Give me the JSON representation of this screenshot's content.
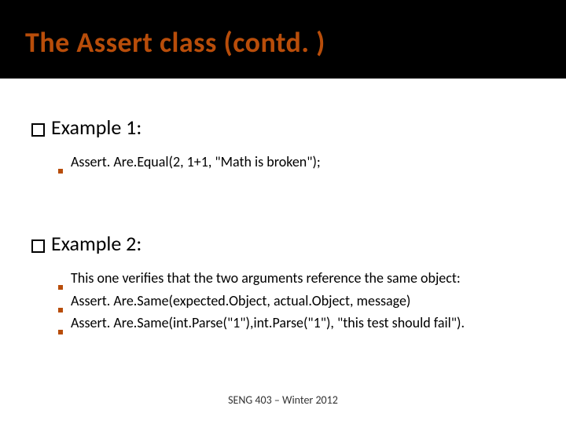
{
  "title": "The Assert class (contd. )",
  "section1": {
    "heading": "Example 1:",
    "items": [
      "Assert. Are.Equal(2, 1+1, \"Math is broken\");"
    ]
  },
  "section2": {
    "heading": "Example 2:",
    "items": [
      "This one verifies that the two arguments reference the same object:",
      "Assert. Are.Same(expected.Object, actual.Object, message)",
      "Assert. Are.Same(int.Parse(\"1\"),int.Parse(\"1\"), \"this test should fail\")."
    ]
  },
  "footer": "SENG 403 – Winter 2012"
}
